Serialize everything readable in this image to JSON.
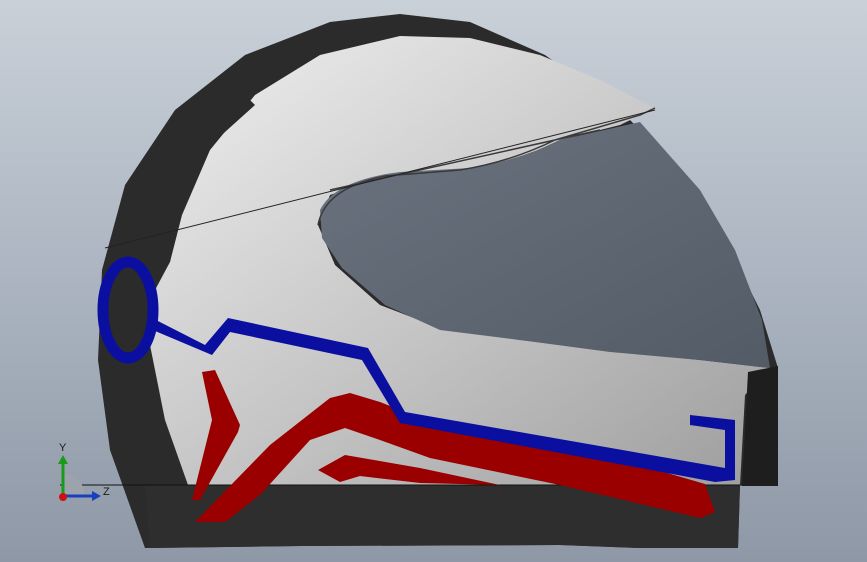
{
  "view": {
    "model": "helmet",
    "colors": {
      "background_top": "#c9d0d8",
      "background_bottom": "#8e98a6",
      "shell_dark": "#2a2a2a",
      "shell_light": "#c8c8c8",
      "visor": "#5c6470",
      "stripe_blue": "#0a0fa0",
      "stripe_red": "#9a0000"
    }
  },
  "triad": {
    "y_label": "Y",
    "z_label": "Z",
    "y_color": "#1a9a1a",
    "z_color": "#1a3fbf",
    "origin_color": "#cc1111"
  }
}
